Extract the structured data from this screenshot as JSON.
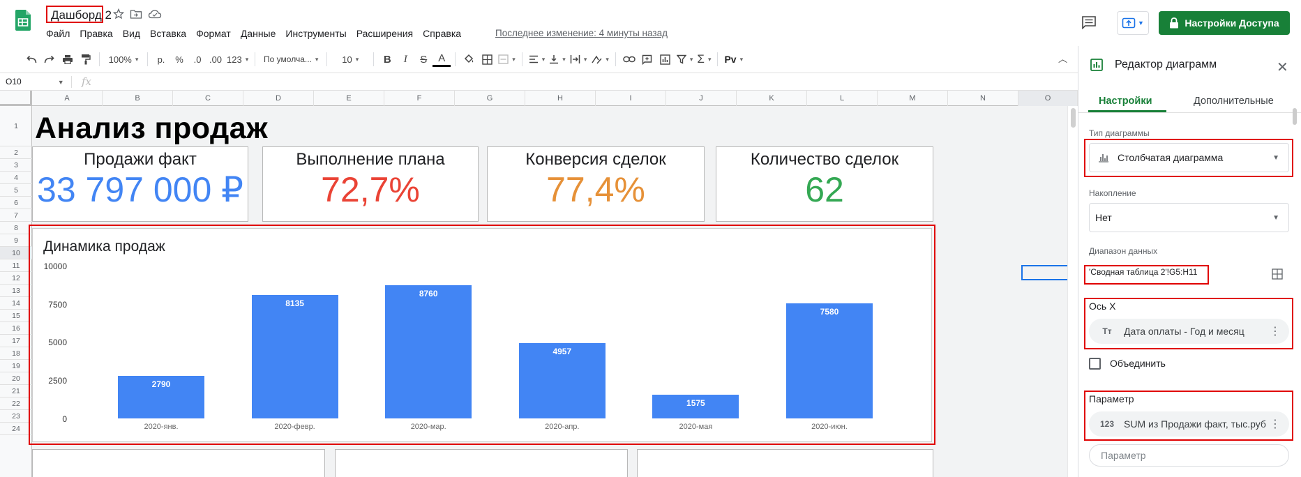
{
  "app": {
    "doc_title": "Дашборд 2",
    "menu": [
      "Файл",
      "Правка",
      "Вид",
      "Вставка",
      "Формат",
      "Данные",
      "Инструменты",
      "Расширения",
      "Справка"
    ],
    "last_edit": "Последнее изменение: 4 минуты назад",
    "share_label": "Настройки Доступа",
    "brand_color": "#188038"
  },
  "toolbar": {
    "zoom": "100%",
    "currency": "р.",
    "percent": "%",
    "dec_decrease": ".0",
    "dec_increase": ".00",
    "number_format": "123",
    "font": "По умолча...",
    "font_size": "10",
    "bold": "B",
    "italic": "I",
    "strike": "S",
    "text_color": "A",
    "addon": "Pv"
  },
  "formula_bar": {
    "name_box": "O10",
    "fx": "fx"
  },
  "grid": {
    "columns": [
      "A",
      "B",
      "C",
      "D",
      "E",
      "F",
      "G",
      "H",
      "I",
      "J",
      "K",
      "L",
      "M",
      "N",
      "O"
    ],
    "rows": [
      "1",
      "2",
      "3",
      "4",
      "5",
      "6",
      "7",
      "8",
      "9",
      "10",
      "11",
      "12",
      "13",
      "14",
      "15",
      "16",
      "17",
      "18",
      "19",
      "20",
      "21",
      "22",
      "23",
      "24"
    ]
  },
  "sheet": {
    "title": "Анализ продаж",
    "kpis": [
      {
        "label": "Продажи факт",
        "value": "33 797 000 ₽",
        "color": "#4285f4"
      },
      {
        "label": "Выполнение плана",
        "value": "72,7%",
        "color": "#ea4335"
      },
      {
        "label": "Конверсия сделок",
        "value": "77,4%",
        "color": "#e69138"
      },
      {
        "label": "Количество сделок",
        "value": "62",
        "color": "#34a853"
      }
    ]
  },
  "chart_data": {
    "type": "bar",
    "title": "Динамика продаж",
    "categories": [
      "2020-янв.",
      "2020-февр.",
      "2020-мар.",
      "2020-апр.",
      "2020-мая",
      "2020-июн."
    ],
    "values": [
      2790,
      8135,
      8760,
      4957,
      1575,
      7580
    ],
    "y_ticks": [
      "10000",
      "7500",
      "5000",
      "2500",
      "0"
    ],
    "ylim": [
      0,
      10000
    ],
    "bar_color": "#4285f4",
    "grid": false,
    "legend": "none"
  },
  "panel": {
    "title": "Редактор диаграмм",
    "tabs": [
      "Настройки",
      "Дополнительные"
    ],
    "chart_type_label": "Тип диаграммы",
    "chart_type_value": "Столбчатая диаграмма",
    "stacking_label": "Накопление",
    "stacking_value": "Нет",
    "range_label": "Диапазон данных",
    "range_value": "'Сводная таблица 2'!G5:H11",
    "x_axis_label": "Ось X",
    "x_axis_chip": "Дата оплаты - Год и месяц",
    "x_axis_chip_icon": "Tт",
    "aggregate_label": "Объединить",
    "series_label": "Параметр",
    "series_chip": "SUM из Продажи факт, тыс.руб",
    "series_chip_icon": "123",
    "add_series_placeholder": "Параметр"
  }
}
